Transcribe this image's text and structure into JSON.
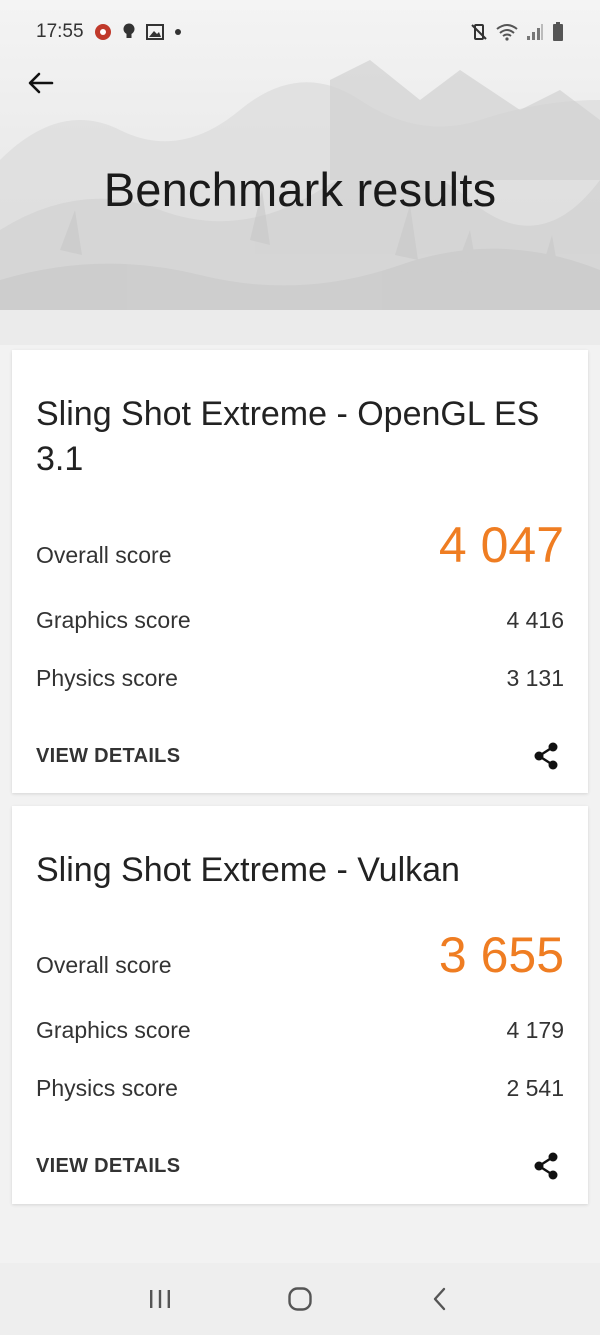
{
  "status_bar": {
    "time": "17:55",
    "icons_left": [
      "game-app-icon",
      "bulb-icon",
      "gallery-icon",
      "dot-icon"
    ],
    "icons_right": [
      "mute-vibrate-icon",
      "wifi-icon",
      "signal-icon",
      "battery-icon"
    ]
  },
  "header": {
    "title": "Benchmark results",
    "back_icon": "arrow-left-icon"
  },
  "cards": [
    {
      "title": "Sling Shot Extreme - OpenGL ES 3.1",
      "overall_label": "Overall score",
      "overall_value": "4 047",
      "graphics_label": "Graphics score",
      "graphics_value": "4 416",
      "physics_label": "Physics score",
      "physics_value": "3 131",
      "details_label": "VIEW DETAILS",
      "share_icon": "share-icon"
    },
    {
      "title": "Sling Shot Extreme - Vulkan",
      "overall_label": "Overall score",
      "overall_value": "3 655",
      "graphics_label": "Graphics score",
      "graphics_value": "4 179",
      "physics_label": "Physics score",
      "physics_value": "2 541",
      "details_label": "VIEW DETAILS",
      "share_icon": "share-icon"
    }
  ],
  "nav_bar": {
    "buttons": [
      "recents-icon",
      "home-icon",
      "back-icon"
    ]
  },
  "colors": {
    "accent": "#ef7d22",
    "text": "#222222",
    "card_bg": "#ffffff",
    "page_bg": "#f2f2f2"
  }
}
